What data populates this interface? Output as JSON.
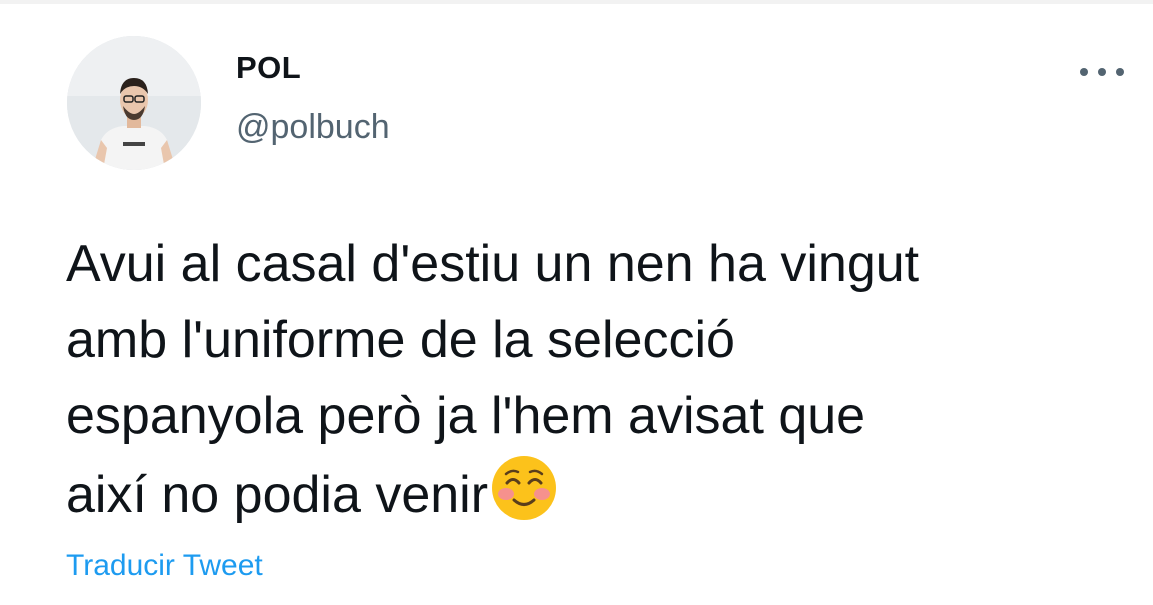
{
  "tweet": {
    "author_name": "POL",
    "author_handle": "@polbuch",
    "lines": [
      "Avui al casal d'estiu un nen ha vingut",
      "amb l'uniforme de la selecció",
      "espanyola però ja l'hem avisat que",
      "així no podia venir"
    ],
    "emoji": "smiling-face-with-smiling-eyes",
    "translate_link": "Traducir Tweet"
  },
  "icons": {
    "more": "more-horizontal-icon",
    "avatar": "profile-photo"
  },
  "colors": {
    "text": "#0f1419",
    "secondary": "#536471",
    "link": "#1d9bf0"
  }
}
